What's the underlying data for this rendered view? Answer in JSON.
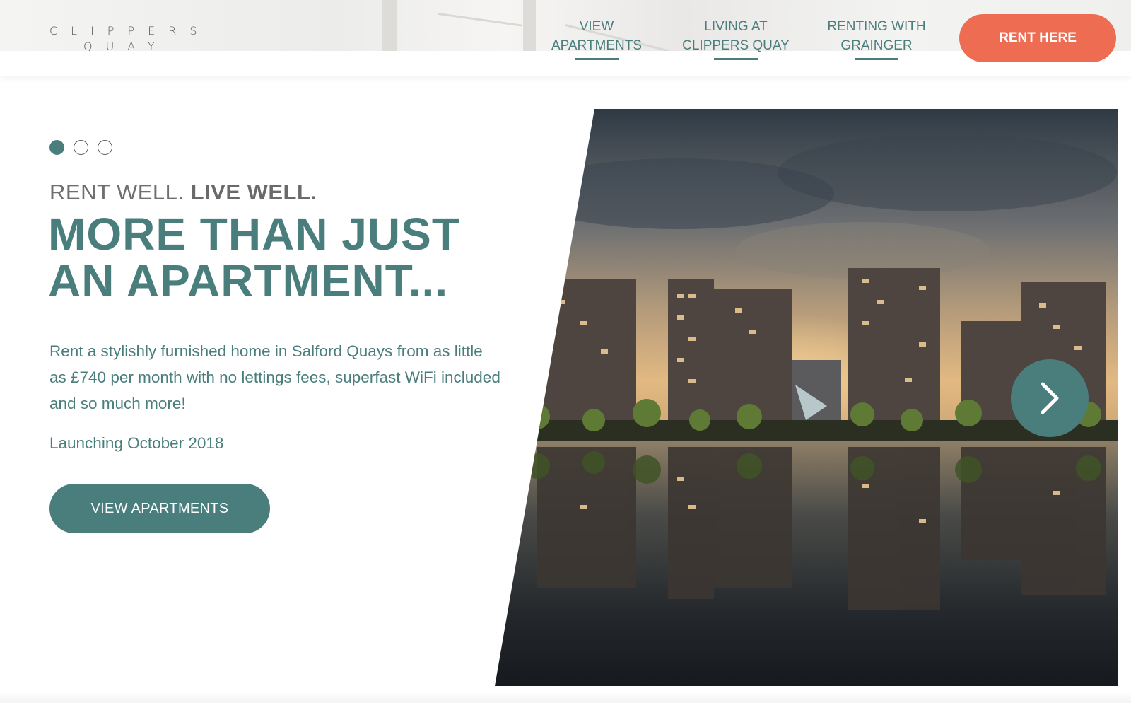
{
  "header": {
    "logo_line1": "CLIPPERS",
    "logo_line2": "QUAY",
    "nav": [
      {
        "line1": "VIEW",
        "line2": "APARTMENTS"
      },
      {
        "line1": "LIVING AT",
        "line2": "CLIPPERS QUAY"
      },
      {
        "line1": "RENTING WITH",
        "line2": "GRAINGER"
      }
    ],
    "cta_label": "RENT HERE"
  },
  "hero": {
    "slides_count": 3,
    "active_slide": 1,
    "tagline_light": "RENT WELL.",
    "tagline_bold": "LIVE WELL.",
    "headline_line1": "MORE THAN JUST",
    "headline_line2": "AN APARTMENT...",
    "description": "Rent a stylishly furnished home in Salford Quays from as little as £740 per month with no lettings fees, superfast WiFi included and so much more!",
    "launch_text": "Launching October 2018",
    "cta_label": "VIEW APARTMENTS"
  },
  "colors": {
    "teal": "#4a7e7d",
    "coral": "#ee6c52",
    "grey_text": "#6f6f6f"
  },
  "icons": {
    "next": "chevron-right-icon"
  }
}
